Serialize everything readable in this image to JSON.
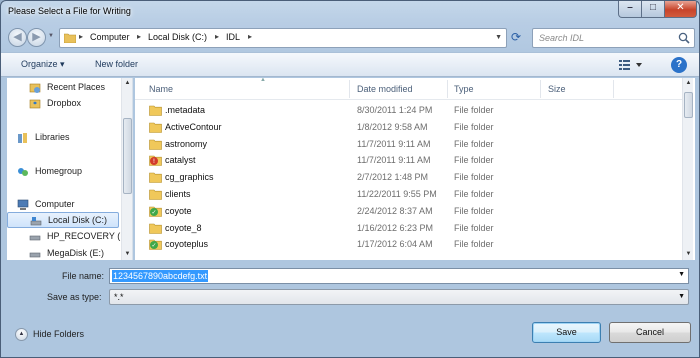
{
  "window": {
    "title": "Please Select a File for Writing"
  },
  "address": {
    "crumbs": [
      "Computer",
      "Local Disk (C:)",
      "IDL"
    ]
  },
  "search": {
    "placeholder": "Search IDL"
  },
  "toolbar": {
    "organize": "Organize ▾",
    "new_folder": "New folder"
  },
  "sidebar": {
    "items": [
      {
        "label": "Recent Places",
        "icon": "recent-places-icon"
      },
      {
        "label": "Dropbox",
        "icon": "dropbox-icon"
      },
      {
        "label": "Libraries",
        "icon": "libraries-icon"
      },
      {
        "label": "Homegroup",
        "icon": "homegroup-icon"
      },
      {
        "label": "Computer",
        "icon": "computer-icon"
      },
      {
        "label": "Local Disk (C:)",
        "icon": "drive-icon"
      },
      {
        "label": "HP_RECOVERY (D",
        "icon": "drive-icon"
      },
      {
        "label": "MegaDisk (E:)",
        "icon": "drive-icon"
      }
    ]
  },
  "columns": {
    "name": "Name",
    "date": "Date modified",
    "type": "Type",
    "size": "Size"
  },
  "files": [
    {
      "name": ".metadata",
      "date": "8/30/2011 1:24 PM",
      "type": "File folder",
      "icon": "folder"
    },
    {
      "name": "ActiveContour",
      "date": "1/8/2012 9:58 AM",
      "type": "File folder",
      "icon": "folder"
    },
    {
      "name": "astronomy",
      "date": "11/7/2011 9:11 AM",
      "type": "File folder",
      "icon": "folder"
    },
    {
      "name": "catalyst",
      "date": "11/7/2011 9:11 AM",
      "type": "File folder",
      "icon": "folder-error"
    },
    {
      "name": "cg_graphics",
      "date": "2/7/2012 1:48 PM",
      "type": "File folder",
      "icon": "folder"
    },
    {
      "name": "clients",
      "date": "11/22/2011 9:55 PM",
      "type": "File folder",
      "icon": "folder"
    },
    {
      "name": "coyote",
      "date": "2/24/2012 8:37 AM",
      "type": "File folder",
      "icon": "folder-synced"
    },
    {
      "name": "coyote_8",
      "date": "1/16/2012 6:23 PM",
      "type": "File folder",
      "icon": "folder"
    },
    {
      "name": "coyoteplus",
      "date": "1/17/2012 6:04 AM",
      "type": "File folder",
      "icon": "folder-synced"
    }
  ],
  "form": {
    "filename_label": "File name:",
    "filename_value": "1234567890abcdefg.txt",
    "savetype_label": "Save as type:",
    "savetype_value": "*.*"
  },
  "footer": {
    "hide_folders": "Hide Folders",
    "save": "Save",
    "cancel": "Cancel"
  },
  "colors": {
    "selection": "#3399ff",
    "accent_link": "#1e395b",
    "folder": "#f0c85a"
  }
}
